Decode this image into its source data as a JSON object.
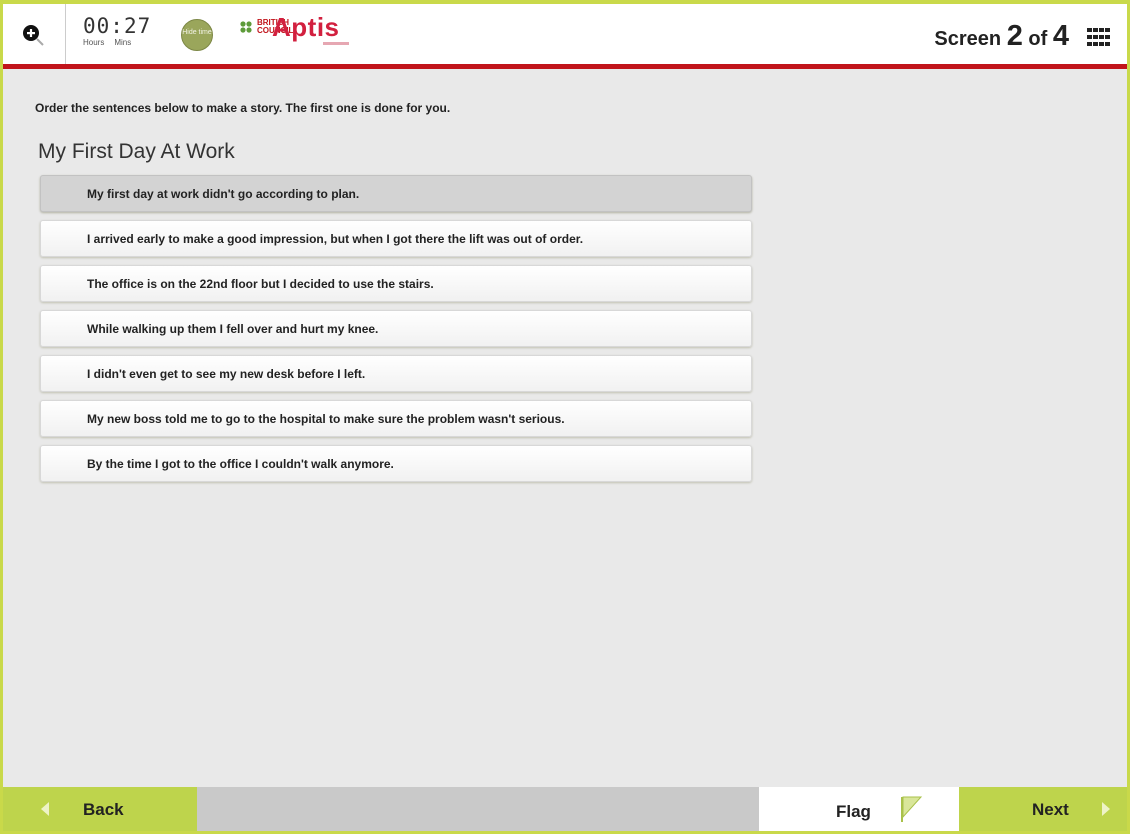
{
  "header": {
    "timer": {
      "hours": "00",
      "separator": ":",
      "minutes": "27",
      "hours_label": "Hours",
      "mins_label": "Mins"
    },
    "hide_time_label": "Hide time",
    "brand": {
      "british_council": "BRITISH COUNCIL",
      "product": "Aptis"
    },
    "screen": {
      "prefix": "Screen",
      "current": "2",
      "of": "of",
      "total": "4"
    },
    "icons": {
      "zoom": "zoom-in-icon",
      "menu": "grid-menu-icon"
    }
  },
  "main": {
    "instruction": "Order the sentences below to make a story. The first one is done for you.",
    "title": "My First Day At Work",
    "sentences": [
      "My first day at work didn't go according to plan.",
      "I arrived early to make a good impression, but when I got there the lift was out of order.",
      "The office is on the 22nd floor but I decided to use the stairs.",
      "While walking up them I fell over and hurt my knee.",
      "I didn't even get to see my new desk before I left.",
      "My new boss told me to go to the hospital to make sure the problem wasn't serious.",
      "By the time I got to the office I couldn't walk anymore."
    ]
  },
  "footer": {
    "back_label": "Back",
    "flag_label": "Flag",
    "next_label": "Next"
  },
  "colors": {
    "accent_green": "#bed44c",
    "header_rule_red": "#c1141b",
    "aptis_red": "#d2203f",
    "hide_time_green": "#9aa65b"
  }
}
